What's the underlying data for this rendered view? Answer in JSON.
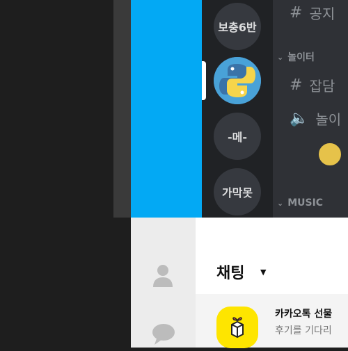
{
  "discord": {
    "servers": [
      {
        "label": "보충6반",
        "icon": "text-avatar"
      },
      {
        "label": "",
        "icon": "python-logo-icon"
      },
      {
        "label": "-메-",
        "icon": "text-avatar"
      },
      {
        "label": "가막못",
        "icon": "text-avatar"
      }
    ],
    "channels": {
      "top_channel": "공지",
      "category_1": "놀이터",
      "text_channel": "잡담",
      "voice_channel": "놀이",
      "category_2": "MUSIC"
    }
  },
  "kakao": {
    "title": "채팅",
    "chat": {
      "name": "카카오톡 선물",
      "preview": "후기를 기다리"
    }
  },
  "colors": {
    "blue_panel": "#03a9f4",
    "kakao_yellow": "#fee500",
    "discord_rail": "#202225",
    "discord_channels": "#2f3136"
  }
}
